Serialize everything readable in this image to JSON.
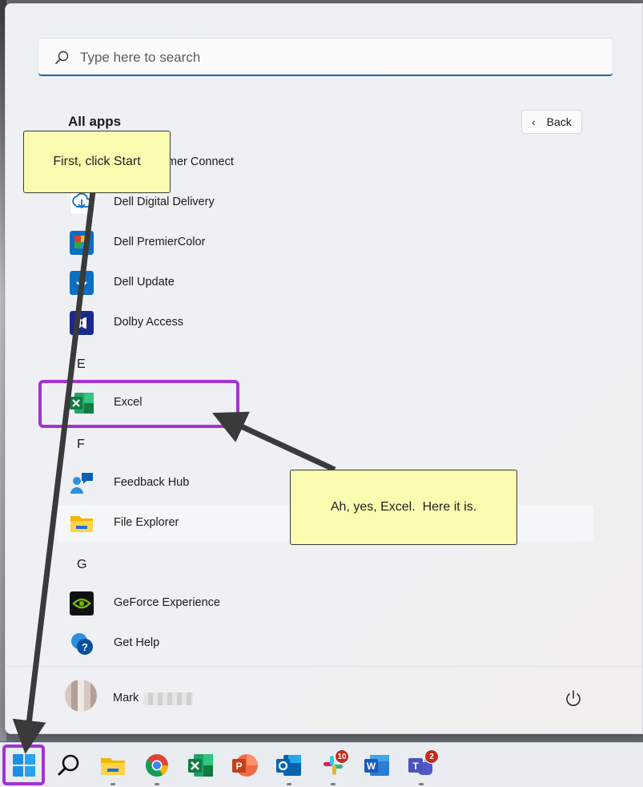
{
  "search": {
    "placeholder": "Type here to search"
  },
  "all_apps": {
    "title": "All apps",
    "back_label": "Back"
  },
  "apps": [
    {
      "label": "Dell Customer Connect",
      "icon": "dell-customer-connect-icon"
    },
    {
      "label": "Dell Digital Delivery",
      "icon": "dell-digital-delivery-icon"
    },
    {
      "label": "Dell PremierColor",
      "icon": "dell-premiercolor-icon"
    },
    {
      "label": "Dell Update",
      "icon": "dell-update-icon"
    },
    {
      "label": "Dolby Access",
      "icon": "dolby-access-icon"
    },
    {
      "label": "Excel",
      "icon": "excel-icon"
    },
    {
      "label": "Feedback Hub",
      "icon": "feedback-hub-icon"
    },
    {
      "label": "File Explorer",
      "icon": "file-explorer-icon"
    },
    {
      "label": "GeForce Experience",
      "icon": "geforce-experience-icon"
    },
    {
      "label": "Get Help",
      "icon": "get-help-icon"
    }
  ],
  "letters": {
    "e": "E",
    "f": "F",
    "g": "G"
  },
  "user": {
    "name": "Mark"
  },
  "taskbar": {
    "badges": {
      "slack": "10",
      "teams": "2"
    }
  },
  "callouts": {
    "start": "First, click Start",
    "excel": "Ah, yes, Excel.  Here it is."
  },
  "colors": {
    "highlight": "#a233d4",
    "callout_bg": "#fbfcb0",
    "search_accent": "#1a5fb4"
  }
}
